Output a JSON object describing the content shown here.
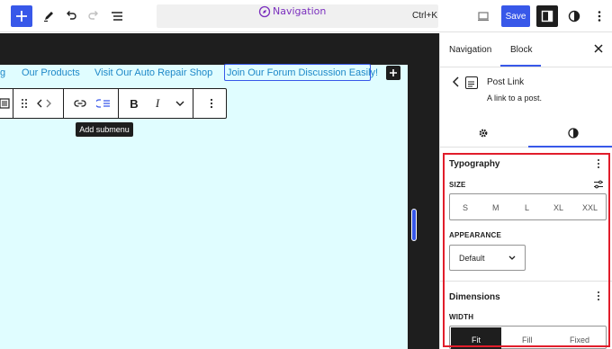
{
  "toolbar": {
    "add_icon": "plus-icon",
    "tool_icon": "pencil-icon",
    "undo_icon": "undo-icon",
    "redo_icon": "redo-icon",
    "outline_icon": "list-view-icon",
    "command_label": "Navigation",
    "command_icon": "compass-icon",
    "shortcut": "Ctrl+K",
    "preview_icon": "desktop-icon",
    "save_label": "Save",
    "settings_icon": "sidebar-icon",
    "styles_icon": "contrast-icon",
    "more_icon": "more-vertical-icon"
  },
  "canvas": {
    "nav_links": [
      {
        "label": "g"
      },
      {
        "label": "Our Products"
      },
      {
        "label": "Visit Our Auto Repair Shop"
      },
      {
        "label": "Join Our Forum Discussion Easily!"
      }
    ],
    "append_icon": "plus-icon",
    "block_toolbar": {
      "icons": [
        "menu-icon",
        "drag-handle-icon",
        "move-arrows-icon",
        "link-icon",
        "add-submenu-icon",
        "bold-icon",
        "italic-icon",
        "chevron-down-icon",
        "more-vertical-icon"
      ],
      "bold_glyph": "B",
      "italic_glyph": "I"
    },
    "tooltip": "Add submenu"
  },
  "sidebar": {
    "tabs": [
      {
        "label": "Navigation"
      },
      {
        "label": "Block"
      }
    ],
    "active_tab": "Block",
    "close_icon": "close-icon",
    "block": {
      "title": "Post Link",
      "description": "A link to a post.",
      "icon": "post-link-icon",
      "back_icon": "chevron-left-icon"
    },
    "subtabs": [
      "settings-gear-icon",
      "styles-contrast-icon"
    ],
    "typography": {
      "heading": "Typography",
      "size_label": "SIZE",
      "size_options": [
        "S",
        "M",
        "L",
        "XL",
        "XXL"
      ],
      "appearance_label": "APPEARANCE",
      "appearance_value": "Default"
    },
    "dimensions": {
      "heading": "Dimensions",
      "width_label": "WIDTH",
      "width_options": [
        "Fit",
        "Fill",
        "Fixed"
      ],
      "width_selected": "Fit"
    },
    "highlight_color": "#e11d2b",
    "accent_color": "#3858e9"
  }
}
